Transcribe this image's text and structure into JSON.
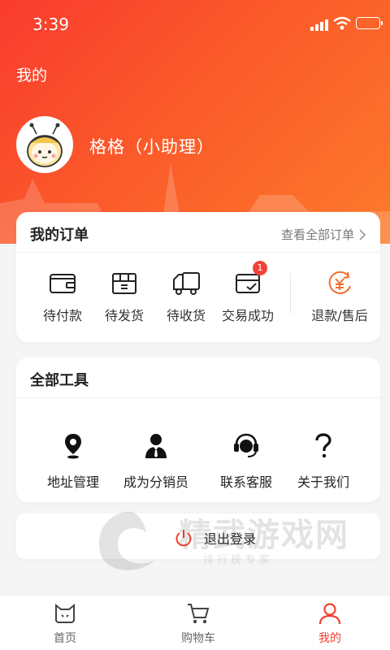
{
  "status_bar": {
    "time": "3:39"
  },
  "header": {
    "title": "我的"
  },
  "profile": {
    "name": "格格（小助理）"
  },
  "orders": {
    "title": "我的订单",
    "view_all": "查看全部订单",
    "items": [
      {
        "label": "待付款",
        "icon": "wallet-icon"
      },
      {
        "label": "待发货",
        "icon": "package-icon"
      },
      {
        "label": "待收货",
        "icon": "truck-icon"
      },
      {
        "label": "交易成功",
        "icon": "card-check-icon",
        "badge": "1"
      },
      {
        "label": "退款/售后",
        "icon": "refund-yen-icon"
      }
    ]
  },
  "tools": {
    "title": "全部工具",
    "items": [
      {
        "label": "地址管理",
        "icon": "location-pin-icon"
      },
      {
        "label": "成为分销员",
        "icon": "user-suit-icon"
      },
      {
        "label": "联系客服",
        "icon": "headset-icon"
      },
      {
        "label": "关于我们",
        "icon": "question-icon"
      }
    ]
  },
  "logout": {
    "label": "退出登录"
  },
  "watermark": {
    "brand": "精武游戏网",
    "tagline": "排 行 榜 专 家"
  },
  "tabbar": {
    "items": [
      {
        "label": "首页",
        "icon": "home-cat-icon"
      },
      {
        "label": "购物车",
        "icon": "cart-icon"
      },
      {
        "label": "我的",
        "icon": "person-icon",
        "active": true
      }
    ]
  },
  "colors": {
    "accent": "#f2402e",
    "gradient_start": "#f93b2e",
    "gradient_end": "#fc7a2b"
  }
}
